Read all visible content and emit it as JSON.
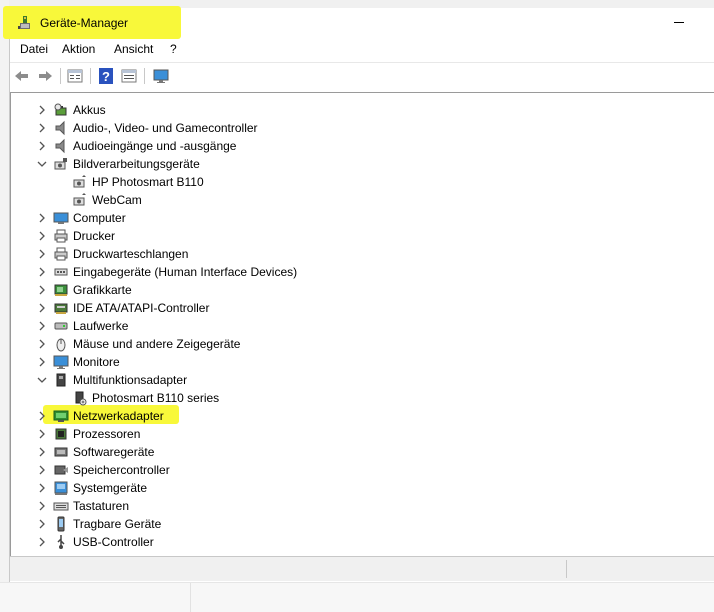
{
  "window": {
    "title": "Geräte-Manager",
    "highlight_color": "#f8f83a"
  },
  "menu": [
    "Datei",
    "Aktion",
    "Ansicht",
    "?"
  ],
  "toolbar": {
    "buttons": [
      "back-arrow-icon",
      "forward-arrow-icon",
      "properties-icon",
      "help-icon",
      "details-view-icon",
      "monitor-icon"
    ]
  },
  "tree": {
    "categories": [
      {
        "label": "Akkus",
        "expanded": false,
        "icon": "battery-icon"
      },
      {
        "label": "Audio-, Video- und Gamecontroller",
        "expanded": false,
        "icon": "speaker-icon"
      },
      {
        "label": "Audioeingänge und -ausgänge",
        "expanded": false,
        "icon": "speaker-icon"
      },
      {
        "label": "Bildverarbeitungsgeräte",
        "expanded": true,
        "icon": "camera-icon",
        "children": [
          {
            "label": "HP Photosmart B110",
            "icon": "camera-device-icon"
          },
          {
            "label": "WebCam",
            "icon": "camera-device-icon"
          }
        ]
      },
      {
        "label": "Computer",
        "expanded": false,
        "icon": "computer-icon"
      },
      {
        "label": "Drucker",
        "expanded": false,
        "icon": "printer-icon"
      },
      {
        "label": "Druckwarteschlangen",
        "expanded": false,
        "icon": "printer-icon"
      },
      {
        "label": "Eingabegeräte (Human Interface Devices)",
        "expanded": false,
        "icon": "hid-icon"
      },
      {
        "label": "Grafikkarte",
        "expanded": false,
        "icon": "display-adapter-icon"
      },
      {
        "label": "IDE ATA/ATAPI-Controller",
        "expanded": false,
        "icon": "ide-controller-icon"
      },
      {
        "label": "Laufwerke",
        "expanded": false,
        "icon": "disk-drive-icon"
      },
      {
        "label": "Mäuse und andere Zeigegeräte",
        "expanded": false,
        "icon": "mouse-icon"
      },
      {
        "label": "Monitore",
        "expanded": false,
        "icon": "monitor-icon"
      },
      {
        "label": "Multifunktionsadapter",
        "expanded": true,
        "icon": "multifunction-icon",
        "children": [
          {
            "label": "Photosmart B110 series",
            "icon": "multifunction-device-icon"
          }
        ]
      },
      {
        "label": "Netzwerkadapter",
        "expanded": false,
        "icon": "network-adapter-icon",
        "highlighted": true
      },
      {
        "label": "Prozessoren",
        "expanded": false,
        "icon": "processor-icon"
      },
      {
        "label": "Softwaregeräte",
        "expanded": false,
        "icon": "software-device-icon"
      },
      {
        "label": "Speichercontroller",
        "expanded": false,
        "icon": "storage-controller-icon"
      },
      {
        "label": "Systemgeräte",
        "expanded": false,
        "icon": "system-device-icon"
      },
      {
        "label": "Tastaturen",
        "expanded": false,
        "icon": "keyboard-icon"
      },
      {
        "label": "Tragbare Geräte",
        "expanded": false,
        "icon": "portable-device-icon"
      },
      {
        "label": "USB-Controller",
        "expanded": false,
        "icon": "usb-icon"
      }
    ]
  }
}
